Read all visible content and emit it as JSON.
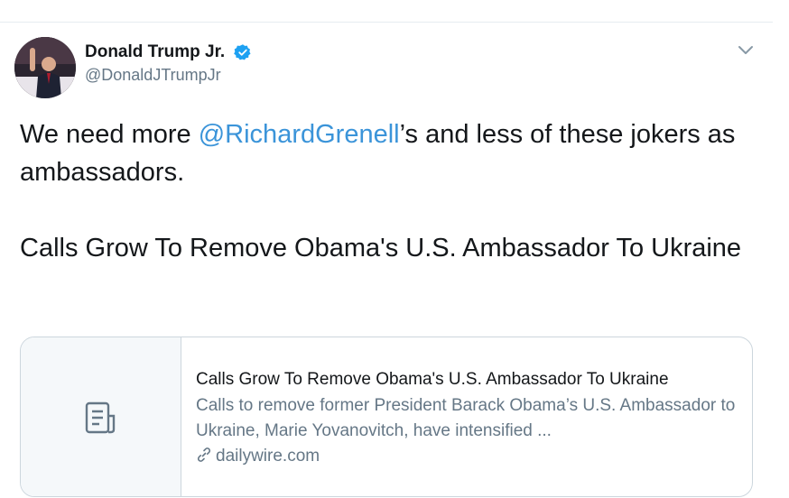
{
  "tweet": {
    "author": {
      "display_name": "Donald Trump Jr.",
      "handle": "@DonaldJTrumpJr",
      "verified_icon": "verified-badge-icon"
    },
    "menu_icon": "chevron-down-icon",
    "text": {
      "line1_prefix": "We need more ",
      "mention": "@RichardGrenell",
      "line1_suffix": "’s and less of these jokers as ambassadors.",
      "line2": "Calls Grow To Remove Obama's U.S. Ambassador To Ukraine"
    },
    "card": {
      "thumbnail_icon": "document-icon",
      "title": "Calls Grow To Remove Obama's U.S. Ambassador To Ukraine",
      "description": "Calls to remove former President Barack Obama’s U.S. Ambassador to Ukraine, Marie Yovanovitch, have intensified ...",
      "link_icon": "link-icon",
      "domain": "dailywire.com"
    }
  },
  "colors": {
    "mention": "#3b94d9",
    "secondary_text": "#657786",
    "verified": "#1da1f2",
    "border": "#ccd6dd"
  }
}
